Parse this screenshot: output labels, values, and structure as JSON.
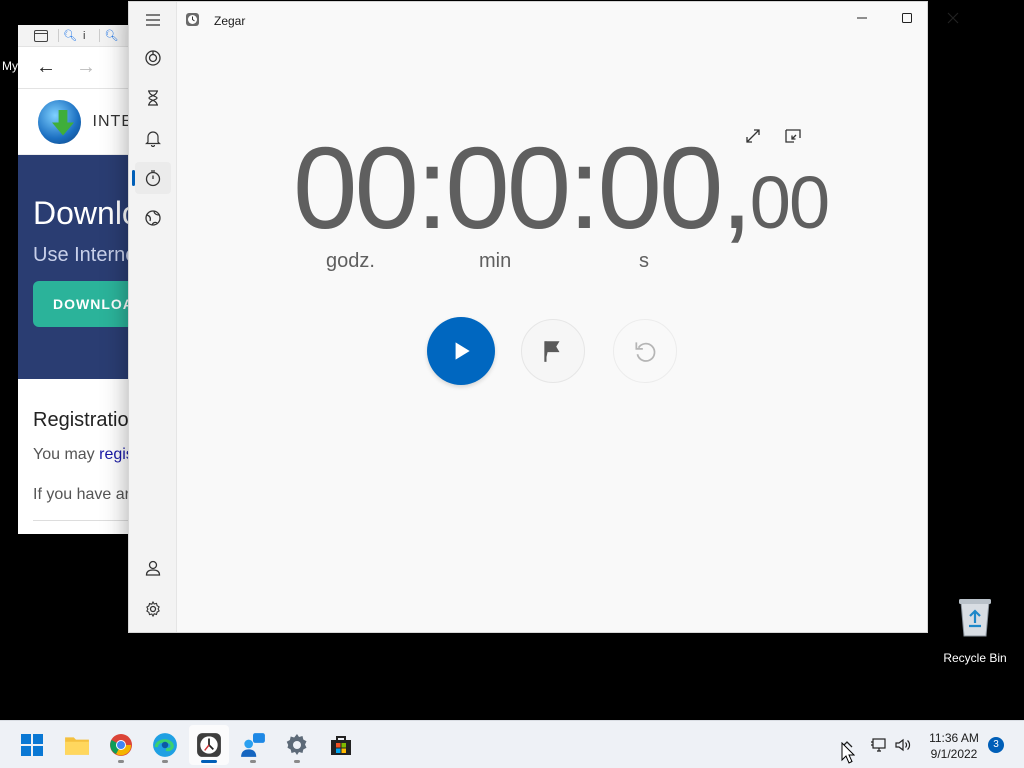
{
  "desktop": {
    "partial_label": "My"
  },
  "browser": {
    "tab_text": "i",
    "brand": "INTE",
    "hero_title": "Downlo",
    "hero_subtitle": "Use Interne",
    "download_button": "DOWNLOA",
    "reg_heading": "Registratio",
    "reg_line1_prefix": "You may ",
    "reg_line1_link": "regis",
    "reg_line2": "If you have ar"
  },
  "clock_app": {
    "title": "Zegar",
    "stopwatch": {
      "hours": "00",
      "sep1": ":",
      "minutes": "00",
      "sep2": ":",
      "seconds": "00",
      "decimal_sep": ",",
      "hundredths": "00"
    },
    "units": {
      "hours": "godz.",
      "minutes": "min",
      "seconds": "s"
    },
    "active_nav": "stopwatch",
    "accent": "#0067c0"
  },
  "desktop_icons": {
    "recycle_bin": "Recycle Bin"
  },
  "taskbar": {
    "time": "11:36 AM",
    "date": "9/1/2022",
    "notification_count": "3",
    "apps": [
      "start",
      "file-explorer",
      "chrome",
      "edge",
      "clock",
      "teams",
      "settings",
      "store"
    ]
  }
}
